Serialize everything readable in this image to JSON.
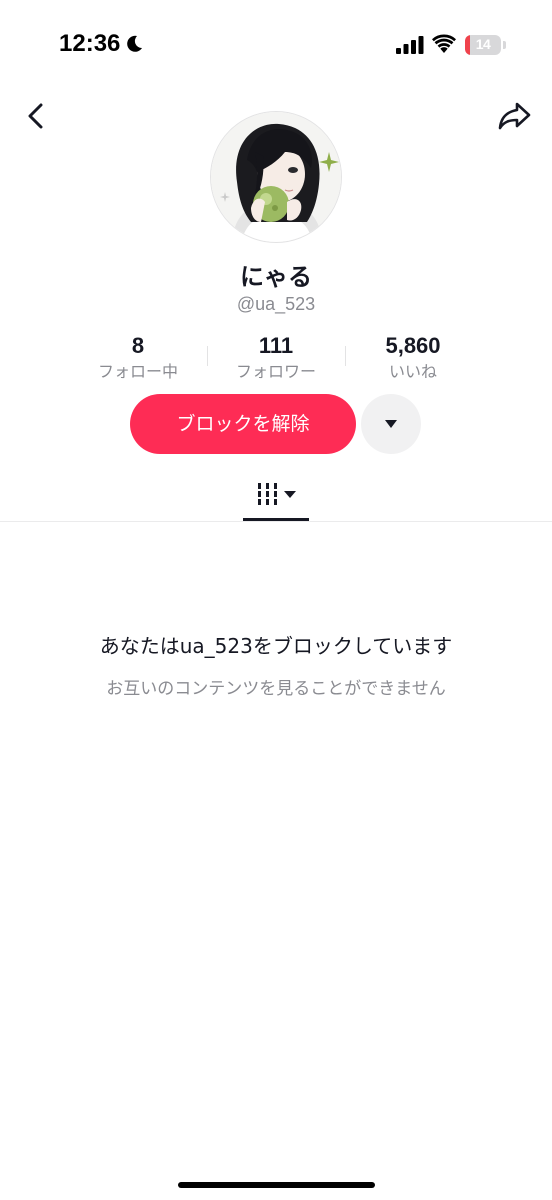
{
  "status_bar": {
    "time": "12:36",
    "battery_level": "14",
    "battery_fraction": 0.14,
    "battery_color": "#f0424c",
    "icons": [
      "moon-icon",
      "signal-icon",
      "wifi-icon",
      "battery-icon"
    ]
  },
  "header": {
    "back_icon": "chevron-left-icon",
    "share_icon": "share-arrow-icon"
  },
  "profile": {
    "display_name": "にゃる",
    "username": "@ua_523"
  },
  "stats": [
    {
      "value": "8",
      "label": "フォロー中"
    },
    {
      "value": "111",
      "label": "フォロワー"
    },
    {
      "value": "5,860",
      "label": "いいね"
    }
  ],
  "actions": {
    "unblock_label": "ブロックを解除",
    "more_icon": "caret-down-icon"
  },
  "tabs": {
    "videos_icon": "video-grid-icon"
  },
  "blocked": {
    "title": "あなたはua_523をブロックしています",
    "subtitle": "お互いのコンテンツを見ることができません"
  },
  "colors": {
    "accent": "#fe2c55",
    "text_primary": "#161823",
    "text_secondary": "#8a8b91"
  }
}
